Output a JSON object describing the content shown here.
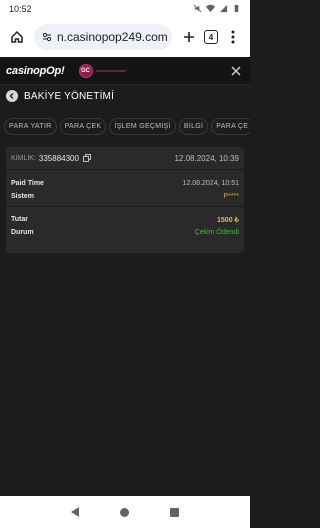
{
  "statusbar": {
    "time": "10:52"
  },
  "browser": {
    "url": "n.casinopop249.com",
    "tab_count": "4"
  },
  "site": {
    "logo_main": "casino",
    "logo_pop": "pOp!",
    "badge": "GC"
  },
  "page": {
    "title": "BAKİYE YÖNETİMİ"
  },
  "tabs": [
    "PARA YATIR",
    "PARA ÇEK",
    "İŞLEM GEÇMİŞİ",
    "BİLGİ",
    "PARA ÇE"
  ],
  "transaction": {
    "id_label": "KİMLİK:",
    "id_value": "335884300",
    "created": "12.08.2024, 10:39",
    "paid_time_label": "Paid Time",
    "paid_time_value": "12.08.2024, 10:51",
    "system_label": "Sistem",
    "system_value": "P****",
    "amount_label": "Tutar",
    "amount_value": "1500 ₺",
    "status_label": "Durum",
    "status_value": "Çekim Ödendi"
  },
  "colors": {
    "amount": "#ffb33a",
    "status": "#3fb93f",
    "system": "#e8a33a"
  }
}
